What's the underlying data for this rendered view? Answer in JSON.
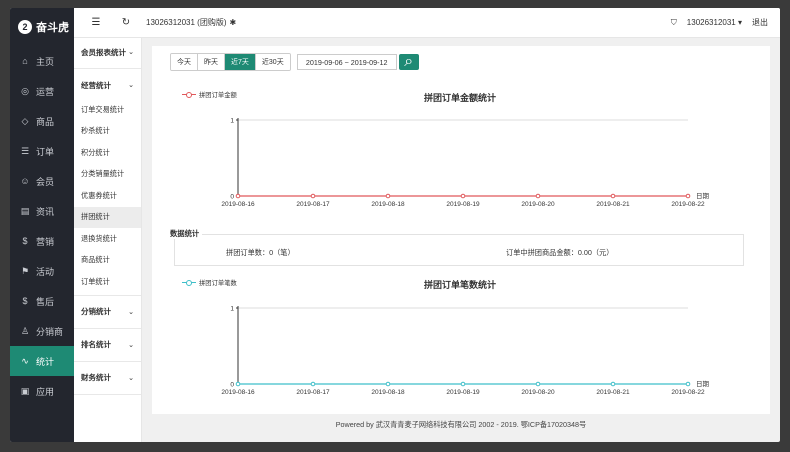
{
  "brand": {
    "name": "奋斗虎",
    "mark": "2"
  },
  "sidebar": {
    "items": [
      {
        "label": "主页",
        "icon": "⌂",
        "active": false
      },
      {
        "label": "运营",
        "icon": "◎",
        "active": false
      },
      {
        "label": "商品",
        "icon": "◇",
        "active": false
      },
      {
        "label": "订单",
        "icon": "☰",
        "active": false
      },
      {
        "label": "会员",
        "icon": "☺",
        "active": false
      },
      {
        "label": "资讯",
        "icon": "▤",
        "active": false
      },
      {
        "label": "营销",
        "icon": "$",
        "active": false
      },
      {
        "label": "活动",
        "icon": "⚑",
        "active": false
      },
      {
        "label": "售后",
        "icon": "$",
        "active": false
      },
      {
        "label": "分销商",
        "icon": "♙",
        "active": false
      },
      {
        "label": "统计",
        "icon": "∿",
        "active": true
      },
      {
        "label": "应用",
        "icon": "▣",
        "active": false
      }
    ]
  },
  "topbar": {
    "menu_icon": "☰",
    "refresh_icon": "↻",
    "account_label": "13026312031 (团购版)",
    "settings_icon": "✱",
    "shirt_icon": "⛉",
    "user_label": "13026312031",
    "dropdown_icon": "▾",
    "logout_label": "退出"
  },
  "subnav": {
    "groups": [
      {
        "title": "会员报表统计",
        "items": []
      },
      {
        "title": "经营统计",
        "items": [
          {
            "label": "订单交易统计",
            "active": false
          },
          {
            "label": "秒杀统计",
            "active": false
          },
          {
            "label": "积分统计",
            "active": false
          },
          {
            "label": "分类销量统计",
            "active": false
          },
          {
            "label": "优惠券统计",
            "active": false
          },
          {
            "label": "拼团统计",
            "active": true
          },
          {
            "label": "退换货统计",
            "active": false
          },
          {
            "label": "商品统计",
            "active": false
          },
          {
            "label": "订单统计",
            "active": false
          }
        ]
      },
      {
        "title": "分销统计",
        "items": []
      },
      {
        "title": "排名统计",
        "items": []
      },
      {
        "title": "财务统计",
        "items": []
      }
    ],
    "chevron": "⌄"
  },
  "filter": {
    "ranges": [
      {
        "label": "今天",
        "active": false
      },
      {
        "label": "昨天",
        "active": false
      },
      {
        "label": "近7天",
        "active": true
      },
      {
        "label": "近30天",
        "active": false
      }
    ],
    "date_range": "2019-09-06 ~ 2019-09-12",
    "search_icon": "⌕"
  },
  "stats": {
    "title": "数据统计",
    "order_count": "拼团订单数：0（笔）",
    "order_amount": "订单中拼团商品金额：0.00（元）"
  },
  "colors": {
    "accent": "#1e8a74",
    "series_amount": "#e0585b",
    "series_count": "#3fbfc9"
  },
  "chart_data": [
    {
      "type": "line",
      "title": "拼团订单金额统计",
      "categories": [
        "2019-08-16",
        "2019-08-17",
        "2019-08-18",
        "2019-08-19",
        "2019-08-20",
        "2019-08-21",
        "2019-08-22"
      ],
      "series": [
        {
          "name": "拼团订单金额",
          "values": [
            0,
            0,
            0,
            0,
            0,
            0,
            0
          ]
        }
      ],
      "xlabel": "日期",
      "ylim": [
        0,
        1
      ],
      "yticks": [
        "0",
        "1"
      ],
      "grid": true,
      "legend": "top-left"
    },
    {
      "type": "line",
      "title": "拼团订单笔数统计",
      "categories": [
        "2019-08-16",
        "2019-08-17",
        "2019-08-18",
        "2019-08-19",
        "2019-08-20",
        "2019-08-21",
        "2019-08-22"
      ],
      "series": [
        {
          "name": "拼团订单笔数",
          "values": [
            0,
            0,
            0,
            0,
            0,
            0,
            0
          ]
        }
      ],
      "xlabel": "日期",
      "ylim": [
        0,
        1
      ],
      "yticks": [
        "0",
        "1"
      ],
      "grid": true,
      "legend": "top-left"
    }
  ],
  "footer": {
    "text": "Powered by 武汉青青麦子网络科技有限公司 2002 - 2019. 鄂ICP备17020348号"
  }
}
